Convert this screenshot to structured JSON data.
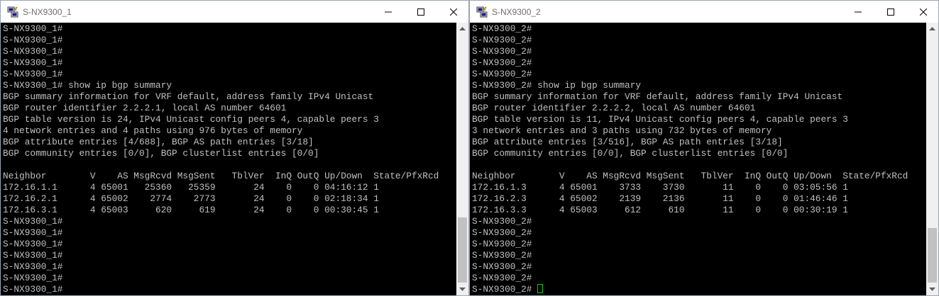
{
  "windows": [
    {
      "title": "S-NX9300_1",
      "icon": "putty-icon",
      "lines": [
        "S-NX9300_1#",
        "S-NX9300_1#",
        "S-NX9300_1#",
        "S-NX9300_1#",
        "S-NX9300_1#",
        "S-NX9300_1# show ip bgp summary",
        "BGP summary information for VRF default, address family IPv4 Unicast",
        "BGP router identifier 2.2.2.1, local AS number 64601",
        "BGP table version is 24, IPv4 Unicast config peers 4, capable peers 3",
        "4 network entries and 4 paths using 976 bytes of memory",
        "BGP attribute entries [4/688], BGP AS path entries [3/18]",
        "BGP community entries [0/0], BGP clusterlist entries [0/0]",
        "",
        "Neighbor        V    AS MsgRcvd MsgSent   TblVer  InQ OutQ Up/Down  State/PfxRcd",
        "172.16.1.1      4 65001   25360   25359       24    0    0 04:16:12 1",
        "172.16.2.1      4 65002    2774    2773       24    0    0 02:18:34 1",
        "172.16.3.1      4 65003     620     619       24    0    0 00:30:45 1",
        "S-NX9300_1#",
        "S-NX9300_1#",
        "S-NX9300_1#",
        "S-NX9300_1#",
        "S-NX9300_1#",
        "S-NX9300_1#",
        "S-NX9300_1#"
      ]
    },
    {
      "title": "S-NX9300_2",
      "icon": "putty-icon",
      "lines": [
        "S-NX9300_2#",
        "S-NX9300_2#",
        "S-NX9300_2#",
        "S-NX9300_2#",
        "S-NX9300_2#",
        "S-NX9300_2# show ip bgp summary",
        "BGP summary information for VRF default, address family IPv4 Unicast",
        "BGP router identifier 2.2.2.2, local AS number 64601",
        "BGP table version is 11, IPv4 Unicast config peers 4, capable peers 3",
        "3 network entries and 3 paths using 732 bytes of memory",
        "BGP attribute entries [3/516], BGP AS path entries [3/18]",
        "BGP community entries [0/0], BGP clusterlist entries [0/0]",
        "",
        "Neighbor        V    AS MsgRcvd MsgSent   TblVer  InQ OutQ Up/Down  State/PfxRcd",
        "172.16.1.3      4 65001    3733    3730       11    0    0 03:05:56 1",
        "172.16.2.3      4 65002    2139    2136       11    0    0 01:46:46 1",
        "172.16.3.3      4 65003     612     610       11    0    0 00:30:19 1",
        "S-NX9300_2#",
        "S-NX9300_2#",
        "S-NX9300_2#",
        "S-NX9300_2#",
        "S-NX9300_2#",
        "S-NX9300_2#"
      ],
      "active_prompt": "S-NX9300_2# "
    }
  ],
  "colors": {
    "terminal_bg": "#000000",
    "terminal_fg": "#c0c0c0",
    "cursor": "#00d000"
  }
}
